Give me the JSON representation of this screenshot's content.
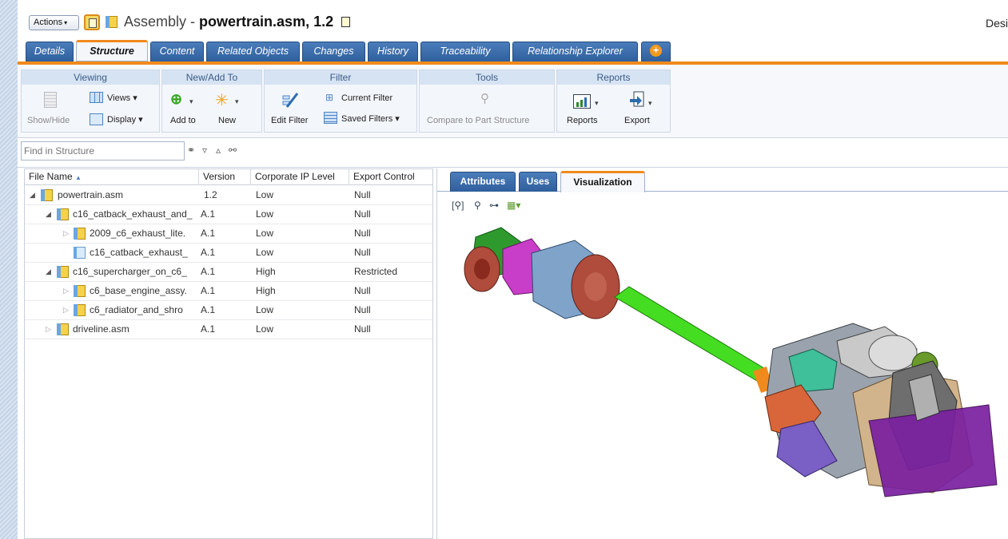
{
  "header": {
    "actions_label": "Actions",
    "title_prefix": "Assembly - ",
    "title_bold": "powertrain.asm, 1.2",
    "right_text": "Desi"
  },
  "tabs": [
    "Details",
    "Structure",
    "Content",
    "Related Objects",
    "Changes",
    "History",
    "Traceability",
    "Relationship Explorer"
  ],
  "ribbon": {
    "viewing": {
      "title": "Viewing",
      "show_hide": "Show/Hide",
      "views": "Views",
      "display": "Display"
    },
    "new_add": {
      "title": "New/Add To",
      "add_to": "Add to",
      "new": "New"
    },
    "filter": {
      "title": "Filter",
      "edit_filter": "Edit Filter",
      "current_filter": "Current Filter",
      "saved_filters": "Saved Filters"
    },
    "tools": {
      "title": "Tools",
      "compare": "Compare to Part Structure"
    },
    "reports": {
      "title": "Reports",
      "reports": "Reports",
      "export": "Export"
    }
  },
  "find": {
    "placeholder": "Find in Structure"
  },
  "structure": {
    "columns": [
      "File Name",
      "Version",
      "Corporate IP Level",
      "Export Control"
    ],
    "rows": [
      {
        "name": "powertrain.asm",
        "version": "1.2",
        "ip": "Low",
        "export": "Null"
      },
      {
        "name": "c16_catback_exhaust_and_",
        "version": "A.1",
        "ip": "Low",
        "export": "Null"
      },
      {
        "name": "2009_c6_exhaust_lite.",
        "version": "A.1",
        "ip": "Low",
        "export": "Null"
      },
      {
        "name": "c16_catback_exhaust_",
        "version": "A.1",
        "ip": "Low",
        "export": "Null"
      },
      {
        "name": "c16_supercharger_on_c6_",
        "version": "A.1",
        "ip": "High",
        "export": "Restricted"
      },
      {
        "name": "c6_base_engine_assy.",
        "version": "A.1",
        "ip": "High",
        "export": "Null"
      },
      {
        "name": "c6_radiator_and_shro",
        "version": "A.1",
        "ip": "Low",
        "export": "Null"
      },
      {
        "name": "driveline.asm",
        "version": "A.1",
        "ip": "Low",
        "export": "Null"
      }
    ]
  },
  "right_tabs": [
    "Attributes",
    "Uses",
    "Visualization"
  ],
  "colors": {
    "accent": "#f08a1c",
    "tab_blue": "#2f5f9c",
    "shaft_green": "#44dd22"
  }
}
